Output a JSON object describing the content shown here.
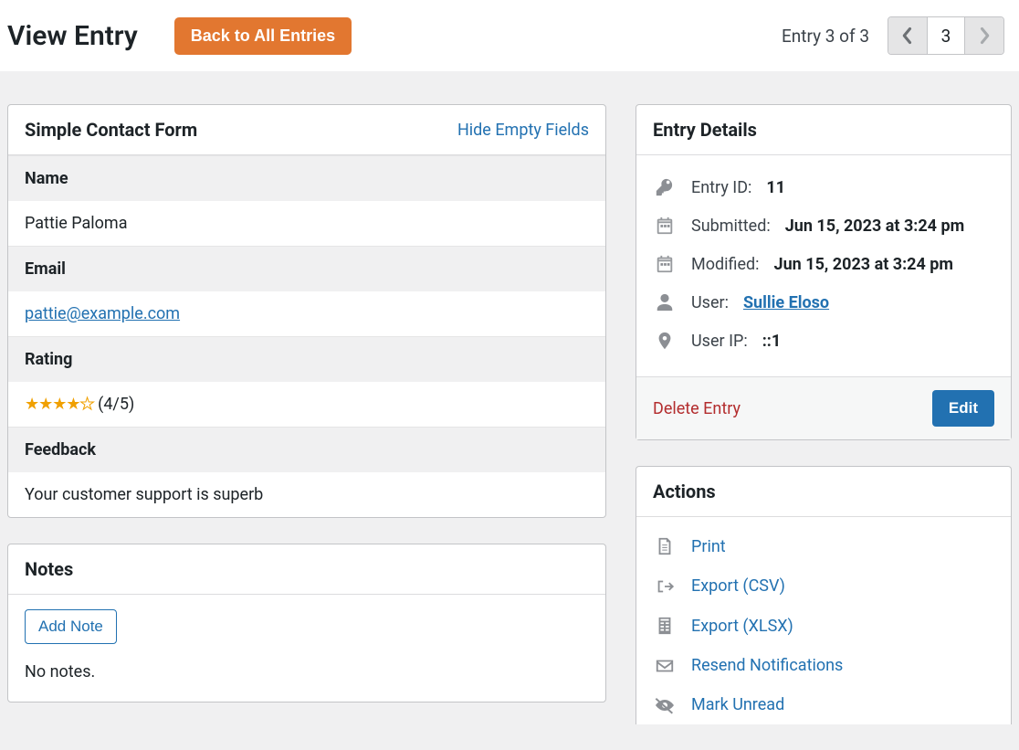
{
  "header": {
    "title": "View Entry",
    "back_button": "Back to All Entries",
    "entry_counter": "Entry 3 of 3",
    "current_page": "3"
  },
  "form_panel": {
    "title": "Simple Contact Form",
    "hide_empty": "Hide Empty Fields",
    "fields": {
      "name_label": "Name",
      "name_value": "Pattie Paloma",
      "email_label": "Email",
      "email_value": "pattie@example.com",
      "rating_label": "Rating",
      "rating_text": "(4/5)",
      "feedback_label": "Feedback",
      "feedback_value": "Your customer support is superb"
    }
  },
  "notes": {
    "title": "Notes",
    "add_button": "Add Note",
    "empty_text": "No notes."
  },
  "details": {
    "title": "Entry Details",
    "entry_id_label": "Entry ID:",
    "entry_id_value": "11",
    "submitted_label": "Submitted:",
    "submitted_value": "Jun 15, 2023 at 3:24 pm",
    "modified_label": "Modified:",
    "modified_value": "Jun 15, 2023 at 3:24 pm",
    "user_label": "User:",
    "user_value": "Sullie Eloso",
    "ip_label": "User IP:",
    "ip_value": "::1",
    "delete": "Delete Entry",
    "edit": "Edit"
  },
  "actions": {
    "title": "Actions",
    "print": "Print",
    "export_csv": "Export (CSV)",
    "export_xlsx": "Export (XLSX)",
    "resend": "Resend Notifications",
    "mark_unread": "Mark Unread"
  }
}
